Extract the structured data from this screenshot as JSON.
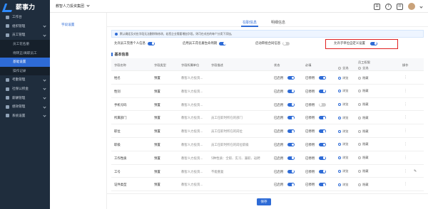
{
  "app": {
    "logo_text": "薪事力",
    "company": "教智人力投资集团"
  },
  "sidebar": {
    "items": [
      {
        "label": "工作台",
        "type": "top",
        "caret": false,
        "active": false
      },
      {
        "label": "组织管理",
        "type": "top",
        "caret": true,
        "active": false
      },
      {
        "label": "员工管理",
        "type": "top",
        "caret": true,
        "active": false
      },
      {
        "label": "员工花名册",
        "type": "sub",
        "caret": false,
        "active": false
      },
      {
        "label": "待转正/离职员工",
        "type": "sub",
        "caret": false,
        "active": false
      },
      {
        "label": "基础设置",
        "type": "sub",
        "caret": false,
        "active": true
      },
      {
        "label": "操作记录",
        "type": "sub",
        "caret": false,
        "active": false
      },
      {
        "label": "考勤管理",
        "type": "top",
        "caret": true,
        "active": false
      },
      {
        "label": "社保公积金",
        "type": "top",
        "caret": true,
        "active": false
      },
      {
        "label": "薪酬管理",
        "type": "top",
        "caret": true,
        "active": false
      },
      {
        "label": "绩效管理",
        "type": "top",
        "caret": true,
        "active": false
      },
      {
        "label": "系统设置",
        "type": "top",
        "caret": true,
        "active": false
      }
    ]
  },
  "subnav": {
    "link": "字段设置"
  },
  "tabs": [
    {
      "label": "在职信息"
    },
    {
      "label": "明细信息"
    }
  ],
  "notice": {
    "text": "默认确定及对应字段无法删除和修改，若您企业需要增加字段，则可在对应的每个分类下添加。"
  },
  "settings": {
    "items": [
      {
        "label": "允许员工完善个人信息",
        "on": true
      },
      {
        "label": "启用员工花名册生命周期",
        "on": true
      },
      {
        "label": "启动审批合同信息",
        "on": false
      },
      {
        "label": "允许子单位自定义设置",
        "on": true
      }
    ]
  },
  "section": {
    "title": "基本信息"
  },
  "table": {
    "headers": {
      "field_name": "字段名称",
      "field_type": "字段类型",
      "field_category": "字段所属单位",
      "field_desc": "字段描述",
      "status": "状态",
      "required": "必填",
      "permission": "员工权限",
      "perm_all": "全选",
      "perm_all2": "全选",
      "ops": "操作"
    },
    "rows": [
      {
        "name": "姓名",
        "type": "预置",
        "unit": "教智人力投资...",
        "desc": "",
        "status": "已启用",
        "status_on": true,
        "required": "已停用",
        "required_on": true,
        "perm": "浏览",
        "hide": "隐藏",
        "perm_sel": "view",
        "ops": "⋮",
        "editable": false
      },
      {
        "name": "性别",
        "type": "预置",
        "unit": "教智人力投资...",
        "desc": "",
        "status": "已启用",
        "status_on": true,
        "required": "已停用",
        "required_on": true,
        "perm": "浏览",
        "hide": "隐藏",
        "perm_sel": "view",
        "ops": "⋮",
        "editable": false
      },
      {
        "name": "手机号码",
        "type": "预置",
        "unit": "教智人力投资...",
        "desc": "",
        "status": "已启用",
        "status_on": true,
        "required": "已停用",
        "required_on": false,
        "perm": "浏览",
        "hide": "隐藏",
        "perm_sel": "view",
        "ops": "⋮",
        "editable": false
      },
      {
        "name": "所属部门",
        "type": "预置",
        "unit": "教智人力投资...",
        "desc": "员工任职时所在的部门",
        "status": "已启用",
        "status_on": true,
        "required": "已停用",
        "required_on": true,
        "perm": "浏览",
        "hide": "隐藏",
        "perm_sel": "view",
        "ops": "⋮",
        "editable": false
      },
      {
        "name": "职位",
        "type": "预置",
        "unit": "教智人力投资...",
        "desc": "员工任职时所在的岗位",
        "status": "已启用",
        "status_on": true,
        "required": "已停用",
        "required_on": true,
        "perm": "浏览",
        "hide": "隐藏",
        "perm_sel": "view",
        "ops": "⋮",
        "editable": false
      },
      {
        "name": "职级",
        "type": "预置",
        "unit": "教智人力投资...",
        "desc": "员工任职时所在的岗位职级",
        "status": "已启用",
        "status_on": true,
        "required": "已停用",
        "required_on": true,
        "perm": "浏览",
        "hide": "隐藏",
        "perm_sel": "view",
        "ops": "⋮",
        "editable": false
      },
      {
        "name": "工作性质",
        "type": "预置",
        "unit": "教智人力投资...",
        "desc": "5种性质：全职、实习、兼职、返聘",
        "status": "已启用",
        "status_on": true,
        "required": "已停用",
        "required_on": true,
        "perm": "浏览",
        "hide": "隐藏",
        "perm_sel": "view",
        "ops": "⋮",
        "editable": false
      },
      {
        "name": "工号",
        "type": "预置",
        "unit": "教智人力投资...",
        "desc": "不能重复",
        "status": "已启用",
        "status_on": true,
        "required": "已停用",
        "required_on": true,
        "perm": "浏览",
        "hide": "隐藏",
        "perm_sel": "view",
        "ops": "⋮",
        "editable": true
      },
      {
        "name": "证件类型",
        "type": "预置",
        "unit": "教智人力投资...",
        "desc": "",
        "status": "已启用",
        "status_on": true,
        "required": "已停用",
        "required_on": true,
        "perm": "浏览",
        "hide": "隐藏",
        "perm_sel": "view",
        "ops": "⋮",
        "editable": false
      }
    ]
  },
  "footer": {
    "save_label": "保存"
  },
  "header_icons": {
    "grid": "⊞",
    "help": "?",
    "bell": "✉"
  },
  "colors": {
    "accent": "#2e6bd6",
    "sidebar": "#1f2d3d",
    "highlight": "#e02020"
  }
}
